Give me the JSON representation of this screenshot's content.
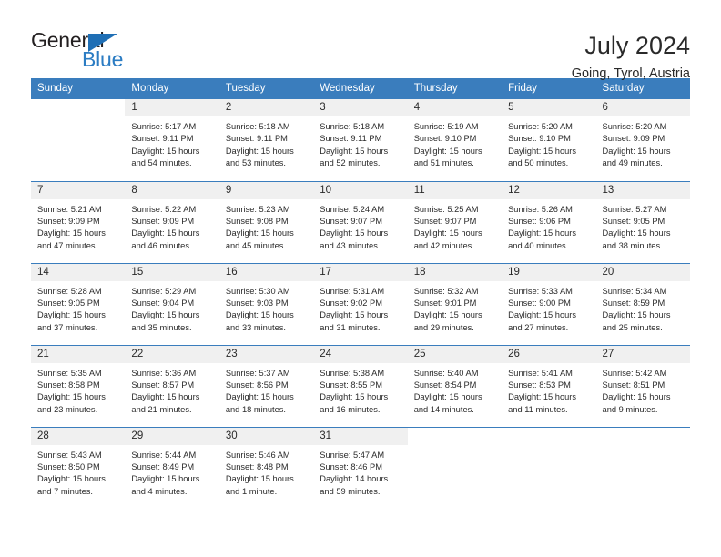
{
  "brand": {
    "name_dark": "General",
    "name_light": "Blue",
    "triangle_icon": "triangle-icon",
    "color_dark": "#231f20",
    "color_light": "#2b7cc3"
  },
  "header": {
    "title": "July 2024",
    "subtitle": "Going, Tyrol, Austria"
  },
  "colors": {
    "header_blue": "#3a7dbd",
    "daynum_bg": "#f0f0f0",
    "text": "#2a2a2a"
  },
  "calendar": {
    "weekday_headers": [
      "Sunday",
      "Monday",
      "Tuesday",
      "Wednesday",
      "Thursday",
      "Friday",
      "Saturday"
    ],
    "weeks": [
      [
        {
          "day": "",
          "lines": []
        },
        {
          "day": "1",
          "lines": [
            "Sunrise: 5:17 AM",
            "Sunset: 9:11 PM",
            "Daylight: 15 hours",
            "and 54 minutes."
          ]
        },
        {
          "day": "2",
          "lines": [
            "Sunrise: 5:18 AM",
            "Sunset: 9:11 PM",
            "Daylight: 15 hours",
            "and 53 minutes."
          ]
        },
        {
          "day": "3",
          "lines": [
            "Sunrise: 5:18 AM",
            "Sunset: 9:11 PM",
            "Daylight: 15 hours",
            "and 52 minutes."
          ]
        },
        {
          "day": "4",
          "lines": [
            "Sunrise: 5:19 AM",
            "Sunset: 9:10 PM",
            "Daylight: 15 hours",
            "and 51 minutes."
          ]
        },
        {
          "day": "5",
          "lines": [
            "Sunrise: 5:20 AM",
            "Sunset: 9:10 PM",
            "Daylight: 15 hours",
            "and 50 minutes."
          ]
        },
        {
          "day": "6",
          "lines": [
            "Sunrise: 5:20 AM",
            "Sunset: 9:09 PM",
            "Daylight: 15 hours",
            "and 49 minutes."
          ]
        }
      ],
      [
        {
          "day": "7",
          "lines": [
            "Sunrise: 5:21 AM",
            "Sunset: 9:09 PM",
            "Daylight: 15 hours",
            "and 47 minutes."
          ]
        },
        {
          "day": "8",
          "lines": [
            "Sunrise: 5:22 AM",
            "Sunset: 9:09 PM",
            "Daylight: 15 hours",
            "and 46 minutes."
          ]
        },
        {
          "day": "9",
          "lines": [
            "Sunrise: 5:23 AM",
            "Sunset: 9:08 PM",
            "Daylight: 15 hours",
            "and 45 minutes."
          ]
        },
        {
          "day": "10",
          "lines": [
            "Sunrise: 5:24 AM",
            "Sunset: 9:07 PM",
            "Daylight: 15 hours",
            "and 43 minutes."
          ]
        },
        {
          "day": "11",
          "lines": [
            "Sunrise: 5:25 AM",
            "Sunset: 9:07 PM",
            "Daylight: 15 hours",
            "and 42 minutes."
          ]
        },
        {
          "day": "12",
          "lines": [
            "Sunrise: 5:26 AM",
            "Sunset: 9:06 PM",
            "Daylight: 15 hours",
            "and 40 minutes."
          ]
        },
        {
          "day": "13",
          "lines": [
            "Sunrise: 5:27 AM",
            "Sunset: 9:05 PM",
            "Daylight: 15 hours",
            "and 38 minutes."
          ]
        }
      ],
      [
        {
          "day": "14",
          "lines": [
            "Sunrise: 5:28 AM",
            "Sunset: 9:05 PM",
            "Daylight: 15 hours",
            "and 37 minutes."
          ]
        },
        {
          "day": "15",
          "lines": [
            "Sunrise: 5:29 AM",
            "Sunset: 9:04 PM",
            "Daylight: 15 hours",
            "and 35 minutes."
          ]
        },
        {
          "day": "16",
          "lines": [
            "Sunrise: 5:30 AM",
            "Sunset: 9:03 PM",
            "Daylight: 15 hours",
            "and 33 minutes."
          ]
        },
        {
          "day": "17",
          "lines": [
            "Sunrise: 5:31 AM",
            "Sunset: 9:02 PM",
            "Daylight: 15 hours",
            "and 31 minutes."
          ]
        },
        {
          "day": "18",
          "lines": [
            "Sunrise: 5:32 AM",
            "Sunset: 9:01 PM",
            "Daylight: 15 hours",
            "and 29 minutes."
          ]
        },
        {
          "day": "19",
          "lines": [
            "Sunrise: 5:33 AM",
            "Sunset: 9:00 PM",
            "Daylight: 15 hours",
            "and 27 minutes."
          ]
        },
        {
          "day": "20",
          "lines": [
            "Sunrise: 5:34 AM",
            "Sunset: 8:59 PM",
            "Daylight: 15 hours",
            "and 25 minutes."
          ]
        }
      ],
      [
        {
          "day": "21",
          "lines": [
            "Sunrise: 5:35 AM",
            "Sunset: 8:58 PM",
            "Daylight: 15 hours",
            "and 23 minutes."
          ]
        },
        {
          "day": "22",
          "lines": [
            "Sunrise: 5:36 AM",
            "Sunset: 8:57 PM",
            "Daylight: 15 hours",
            "and 21 minutes."
          ]
        },
        {
          "day": "23",
          "lines": [
            "Sunrise: 5:37 AM",
            "Sunset: 8:56 PM",
            "Daylight: 15 hours",
            "and 18 minutes."
          ]
        },
        {
          "day": "24",
          "lines": [
            "Sunrise: 5:38 AM",
            "Sunset: 8:55 PM",
            "Daylight: 15 hours",
            "and 16 minutes."
          ]
        },
        {
          "day": "25",
          "lines": [
            "Sunrise: 5:40 AM",
            "Sunset: 8:54 PM",
            "Daylight: 15 hours",
            "and 14 minutes."
          ]
        },
        {
          "day": "26",
          "lines": [
            "Sunrise: 5:41 AM",
            "Sunset: 8:53 PM",
            "Daylight: 15 hours",
            "and 11 minutes."
          ]
        },
        {
          "day": "27",
          "lines": [
            "Sunrise: 5:42 AM",
            "Sunset: 8:51 PM",
            "Daylight: 15 hours",
            "and 9 minutes."
          ]
        }
      ],
      [
        {
          "day": "28",
          "lines": [
            "Sunrise: 5:43 AM",
            "Sunset: 8:50 PM",
            "Daylight: 15 hours",
            "and 7 minutes."
          ]
        },
        {
          "day": "29",
          "lines": [
            "Sunrise: 5:44 AM",
            "Sunset: 8:49 PM",
            "Daylight: 15 hours",
            "and 4 minutes."
          ]
        },
        {
          "day": "30",
          "lines": [
            "Sunrise: 5:46 AM",
            "Sunset: 8:48 PM",
            "Daylight: 15 hours",
            "and 1 minute."
          ]
        },
        {
          "day": "31",
          "lines": [
            "Sunrise: 5:47 AM",
            "Sunset: 8:46 PM",
            "Daylight: 14 hours",
            "and 59 minutes."
          ]
        },
        {
          "day": "",
          "lines": []
        },
        {
          "day": "",
          "lines": []
        },
        {
          "day": "",
          "lines": []
        }
      ]
    ]
  }
}
